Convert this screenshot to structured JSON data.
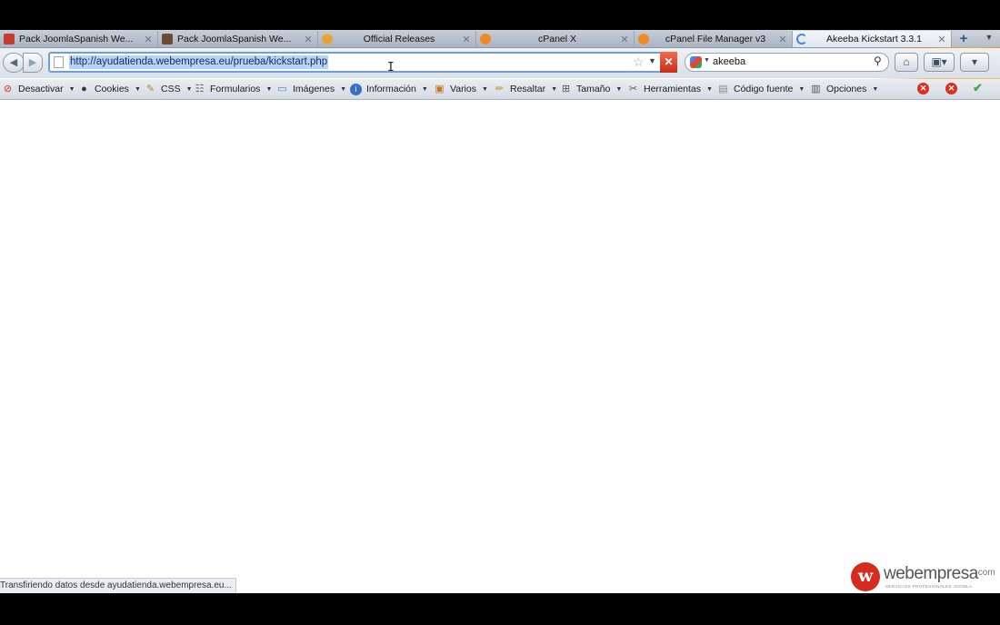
{
  "tabs": [
    {
      "title": "Pack JoomlaSpanish We...",
      "favicon": "joomlaspanish-icon",
      "active": false
    },
    {
      "title": "Pack JoomlaSpanish We...",
      "favicon": "joomlaspanish-icon",
      "active": false
    },
    {
      "title": "Official Releases",
      "favicon": "joomla-icon",
      "active": false
    },
    {
      "title": "cPanel X",
      "favicon": "cpanel-icon",
      "active": false
    },
    {
      "title": "cPanel File Manager v3",
      "favicon": "cpanel-icon",
      "active": false
    },
    {
      "title": "Akeeba Kickstart 3.3.1",
      "favicon": "loading-icon",
      "active": true
    }
  ],
  "address": {
    "url": "http://ayudatienda.webempresa.eu/prueba/kickstart.php"
  },
  "search": {
    "value": "akeeba",
    "engine": "google-icon"
  },
  "devtoolbar": {
    "items": [
      {
        "label": "Desactivar",
        "icon": "disable-icon"
      },
      {
        "label": "Cookies",
        "icon": "cookies-icon"
      },
      {
        "label": "CSS",
        "icon": "css-icon"
      },
      {
        "label": "Formularios",
        "icon": "forms-icon"
      },
      {
        "label": "Imágenes",
        "icon": "images-icon"
      },
      {
        "label": "Información",
        "icon": "information-icon"
      },
      {
        "label": "Varios",
        "icon": "misc-icon"
      },
      {
        "label": "Resaltar",
        "icon": "outline-icon"
      },
      {
        "label": "Tamaño",
        "icon": "resize-icon"
      },
      {
        "label": "Herramientas",
        "icon": "tools-icon"
      },
      {
        "label": "Código fuente",
        "icon": "view-source-icon"
      },
      {
        "label": "Opciones",
        "icon": "options-icon"
      }
    ]
  },
  "status": {
    "text": "Transfiriendo datos desde ayudatienda.webempresa.eu..."
  },
  "watermark": {
    "name": "webempresa",
    "suffix": ".com",
    "tagline": "SERVICIOS PROFESIONALES JOOMLA"
  },
  "colors": {
    "address_focus": "#6f9fdb",
    "selection": "#b5d3ff",
    "stop": "#d9301f",
    "brand_red": "#d62b1f"
  }
}
